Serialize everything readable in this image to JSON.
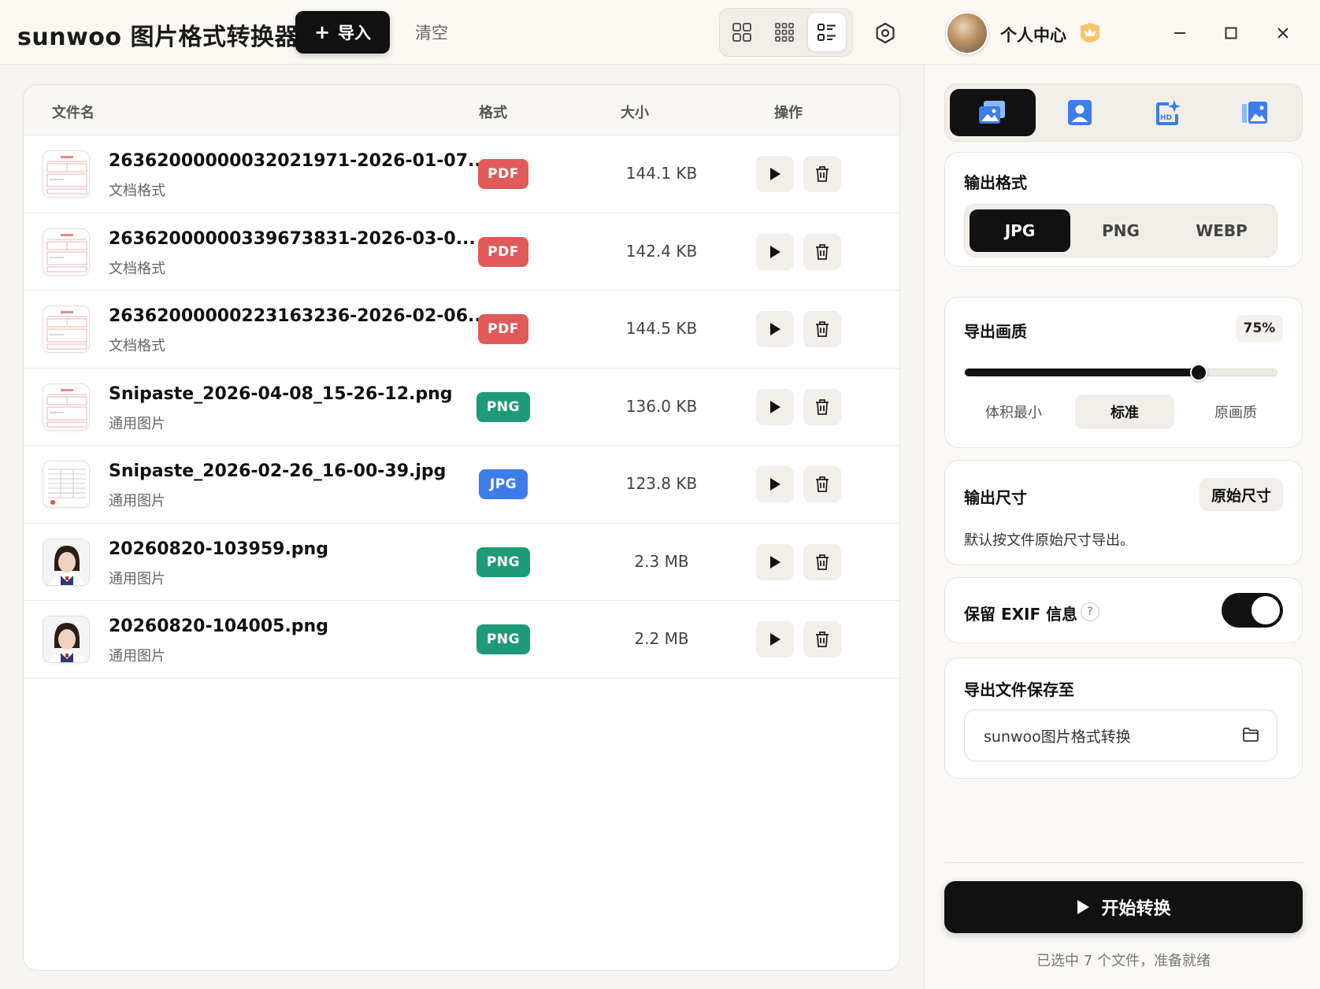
{
  "app": {
    "title": "sunwoo 图片格式转换器",
    "import_label": "导入",
    "clear_label": "清空",
    "user_label": "个人中心"
  },
  "list": {
    "headers": {
      "name": "文件名",
      "format": "格式",
      "size": "大小",
      "actions": "操作"
    },
    "files": [
      {
        "name": "26362000000032021971-2026-01-07....",
        "type": "文档格式",
        "format": "PDF",
        "size": "144.1 KB",
        "thumb": "doc"
      },
      {
        "name": "26362000000339673831-2026-03-0...",
        "type": "文档格式",
        "format": "PDF",
        "size": "142.4 KB",
        "thumb": "doc"
      },
      {
        "name": "26362000000223163236-2026-02-06....",
        "type": "文档格式",
        "format": "PDF",
        "size": "144.5 KB",
        "thumb": "doc"
      },
      {
        "name": "Snipaste_2026-04-08_15-26-12.png",
        "type": "通用图片",
        "format": "PNG",
        "size": "136.0 KB",
        "thumb": "doc"
      },
      {
        "name": "Snipaste_2026-02-26_16-00-39.jpg",
        "type": "通用图片",
        "format": "JPG",
        "size": "123.8 KB",
        "thumb": "table"
      },
      {
        "name": "20260820-103959.png",
        "type": "通用图片",
        "format": "PNG",
        "size": "2.3 MB",
        "thumb": "portrait"
      },
      {
        "name": "20260820-104005.png",
        "type": "通用图片",
        "format": "PNG",
        "size": "2.2 MB",
        "thumb": "portrait"
      }
    ]
  },
  "colors": {
    "PDF": "#e05a5a",
    "PNG": "#1f9a78",
    "JPG": "#3d7de8",
    "accent": "#111111"
  },
  "sidebar": {
    "output_format": {
      "title": "输出格式",
      "options": [
        "JPG",
        "PNG",
        "WEBP"
      ],
      "selected": "JPG"
    },
    "quality": {
      "title": "导出画质",
      "value": 75,
      "value_label": "75%",
      "presets": [
        "体积最小",
        "标准",
        "原画质"
      ],
      "selected_preset": "标准"
    },
    "dimensions": {
      "title": "输出尺寸",
      "chip": "原始尺寸",
      "desc": "默认按文件原始尺寸导出。"
    },
    "exif": {
      "title": "保留 EXIF 信息",
      "help": "?",
      "enabled": true
    },
    "save_path": {
      "title": "导出文件保存至",
      "value": "sunwoo图片格式转换"
    },
    "start_label": "开始转换",
    "status": "已选中 7 个文件，准备就绪"
  }
}
